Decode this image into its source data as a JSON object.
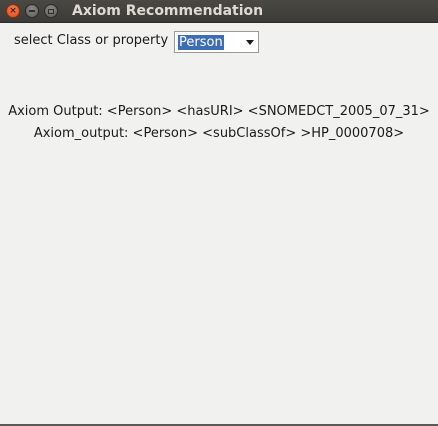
{
  "window": {
    "title": "Axiom Recommendation",
    "controls": [
      "close-icon",
      "minimize-icon",
      "maximize-icon"
    ]
  },
  "form": {
    "select_label": "select Class or property",
    "selected_value": "Person"
  },
  "output": {
    "line1": "Axiom Output: <Person> <hasURI> <SNOMEDCT_2005_07_31>",
    "line2": "Axiom_output: <Person> <subClassOf> >HP_0000708>"
  },
  "colors": {
    "titlebar": "#3c3b37",
    "close_button": "#df4a16",
    "selection_highlight": "#3c6eb4",
    "window_background": "#f1f1f0"
  }
}
